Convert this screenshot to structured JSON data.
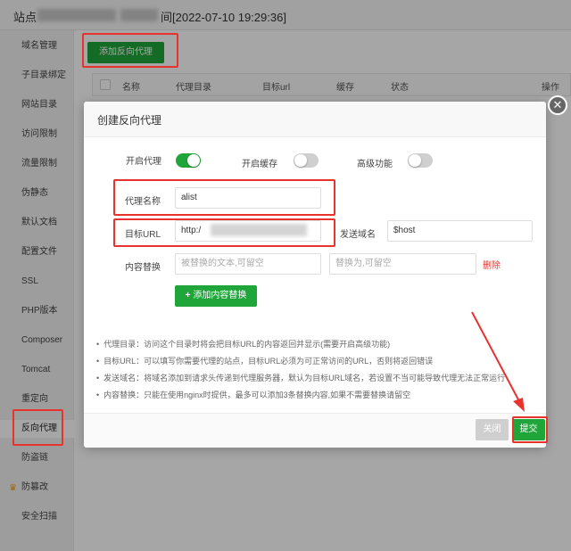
{
  "window": {
    "title_prefix": "站点",
    "title_suffix": "间[2022-07-10 19:29:36]"
  },
  "sidebar": {
    "items": [
      {
        "label": "域名管理"
      },
      {
        "label": "子目录绑定"
      },
      {
        "label": "网站目录"
      },
      {
        "label": "访问限制"
      },
      {
        "label": "流量限制"
      },
      {
        "label": "伪静态"
      },
      {
        "label": "默认文档"
      },
      {
        "label": "配置文件"
      },
      {
        "label": "SSL"
      },
      {
        "label": "PHP版本"
      },
      {
        "label": "Composer"
      },
      {
        "label": "Tomcat"
      },
      {
        "label": "重定向"
      },
      {
        "label": "反向代理"
      },
      {
        "label": "防盗链"
      },
      {
        "label": "防篡改"
      },
      {
        "label": "安全扫描"
      }
    ],
    "active": "反向代理"
  },
  "main": {
    "add_button": "添加反向代理",
    "table_headers": [
      "名称",
      "代理目录",
      "目标url",
      "缓存",
      "状态",
      "操作"
    ]
  },
  "modal": {
    "title": "创建反向代理",
    "enable_proxy_label": "开启代理",
    "enable_proxy": true,
    "enable_cache_label": "开启缓存",
    "enable_cache": false,
    "advanced_label": "高级功能",
    "advanced": false,
    "proxy_name_label": "代理名称",
    "proxy_name_value": "alist",
    "target_url_label": "目标URL",
    "target_url_value": "http:/",
    "send_domain_label": "发送域名",
    "send_domain_value": "$host",
    "content_replace_label": "内容替换",
    "replace_from_placeholder": "被替换的文本,可留空",
    "replace_to_placeholder": "替换为,可留空",
    "delete_label": "删除",
    "add_content_button": "添加内容替换",
    "notes": [
      "代理目录：访问这个目录时将会把目标URL的内容返回并显示(需要开启高级功能)",
      "目标URL：可以填写你需要代理的站点，目标URL必须为可正常访问的URL，否则将返回错误",
      "发送域名：将域名添加到请求头传递到代理服务器，默认为目标URL域名，若设置不当可能导致代理无法正常运行",
      "内容替换：只能在使用nginx时提供，最多可以添加3条替换内容,如果不需要替换请留空"
    ],
    "close_button": "关闭",
    "submit_button": "提交"
  },
  "colors": {
    "brand_green": "#20a53a",
    "annotation_red": "#e8322e"
  }
}
